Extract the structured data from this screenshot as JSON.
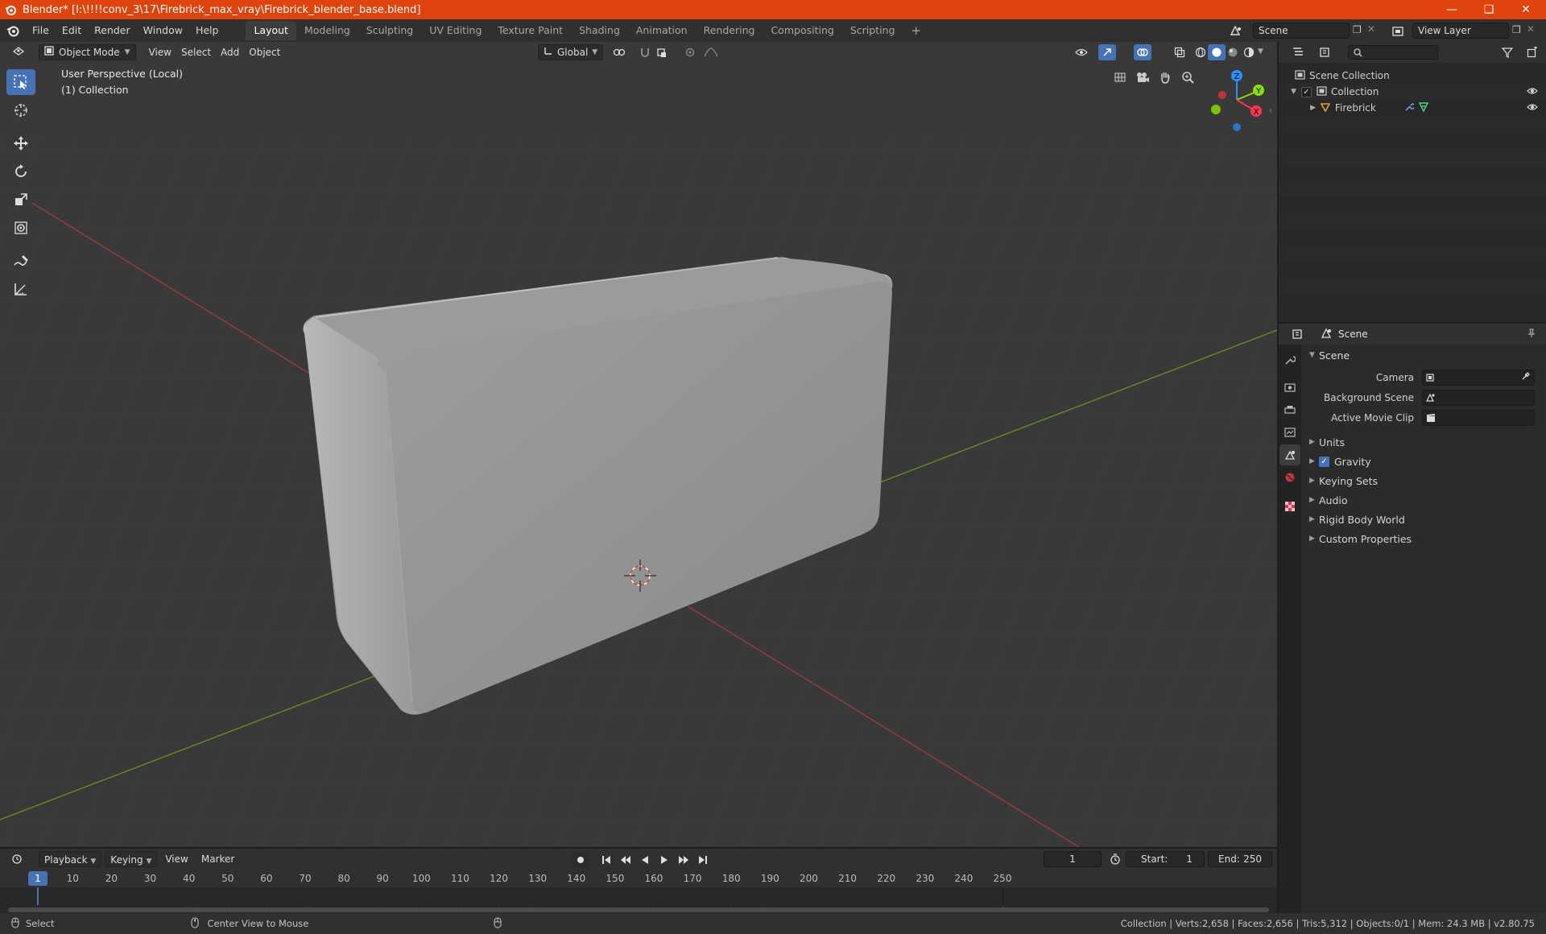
{
  "window": {
    "title": "Blender* [I:\\!!!!conv_3\\17\\Firebrick_max_vray\\Firebrick_blender_base.blend]",
    "controls": [
      "minimize",
      "maximize",
      "close"
    ]
  },
  "menu": {
    "items": [
      "File",
      "Edit",
      "Render",
      "Window",
      "Help"
    ]
  },
  "workspaces": {
    "tabs": [
      "Layout",
      "Modeling",
      "Sculpting",
      "UV Editing",
      "Texture Paint",
      "Shading",
      "Animation",
      "Rendering",
      "Compositing",
      "Scripting"
    ],
    "active": "Layout"
  },
  "scene_field": "Scene",
  "view_layer_field": "View Layer",
  "viewport_header": {
    "mode": "Object Mode",
    "menus": [
      "View",
      "Select",
      "Add",
      "Object"
    ],
    "orientation": "Global"
  },
  "viewport": {
    "perspective": "User Perspective (Local)",
    "collection": "(1) Collection",
    "gizmo_axes": [
      "Z",
      "Y",
      "X"
    ],
    "axis_colors": {
      "x": "#ff3352",
      "y": "#8bdc00",
      "z": "#2890ff"
    }
  },
  "outliner": {
    "search_placeholder": "",
    "rows": [
      {
        "label": "Scene Collection"
      },
      {
        "label": "Collection"
      },
      {
        "label": "Firebrick"
      }
    ]
  },
  "properties": {
    "context_title": "Scene",
    "panel_title": "Scene",
    "fields": [
      {
        "label": "Camera",
        "value": ""
      },
      {
        "label": "Background Scene",
        "value": ""
      },
      {
        "label": "Active Movie Clip",
        "value": ""
      }
    ],
    "subpanels": [
      "Units",
      "Gravity",
      "Keying Sets",
      "Audio",
      "Rigid Body World",
      "Custom Properties"
    ],
    "gravity_enabled": true
  },
  "timeline": {
    "menus": [
      "Playback",
      "Keying",
      "View",
      "Marker"
    ],
    "current_frame": "1",
    "start_label": "Start:",
    "start": "1",
    "end_label": "End:",
    "end": "250",
    "ticks": [
      "10",
      "20",
      "30",
      "40",
      "50",
      "60",
      "70",
      "80",
      "90",
      "100",
      "110",
      "120",
      "130",
      "140",
      "150",
      "160",
      "170",
      "180",
      "190",
      "200",
      "210",
      "220",
      "230",
      "240",
      "250"
    ],
    "playhead": "1"
  },
  "statusbar": {
    "left": "Select",
    "middle": "Center View to Mouse",
    "right": "Collection | Verts:2,658 | Faces:2,656 | Tris:5,312 | Objects:0/1 | Mem: 24.3 MB | v2.80.75"
  },
  "colors": {
    "accent": "#4772b3",
    "titlebar": "#e0440e",
    "object_orange": "#e89a3c"
  }
}
